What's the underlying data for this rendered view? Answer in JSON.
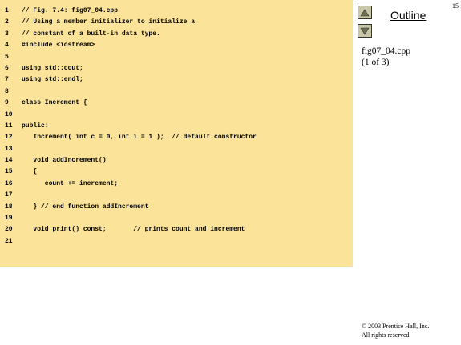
{
  "page_number": "15",
  "nav": {
    "up_icon": "triangle-up",
    "down_icon": "triangle-down",
    "outline_label": "Outline"
  },
  "file_caption": {
    "name": "fig07_04.cpp",
    "pages": "(1 of 3)"
  },
  "copyright": {
    "line1": "© 2003 Prentice Hall, Inc.",
    "line2": "All rights reserved."
  },
  "code": [
    {
      "n": "1",
      "text": "// Fig. 7.4: fig07_04.cpp"
    },
    {
      "n": "2",
      "text": "// Using a member initializer to initialize a"
    },
    {
      "n": "3",
      "text": "// constant of a built-in data type."
    },
    {
      "n": "4",
      "text": "#include <iostream>"
    },
    {
      "n": "5",
      "text": ""
    },
    {
      "n": "6",
      "text": "using std::cout;"
    },
    {
      "n": "7",
      "text": "using std::endl;"
    },
    {
      "n": "8",
      "text": ""
    },
    {
      "n": "9",
      "text": "class Increment {"
    },
    {
      "n": "10",
      "text": ""
    },
    {
      "n": "11",
      "text": "public:"
    },
    {
      "n": "12",
      "text": "   Increment( int c = 0, int i = 1 );  // default constructor"
    },
    {
      "n": "13",
      "text": ""
    },
    {
      "n": "14",
      "text": "   void addIncrement()"
    },
    {
      "n": "15",
      "text": "   {"
    },
    {
      "n": "16",
      "text": "      count += increment;"
    },
    {
      "n": "17",
      "text": ""
    },
    {
      "n": "18",
      "text": "   } // end function addIncrement"
    },
    {
      "n": "19",
      "text": ""
    },
    {
      "n": "20",
      "text": "   void print() const;       // prints count and increment"
    },
    {
      "n": "21",
      "text": ""
    }
  ],
  "colors": {
    "code_background": "#fbe49a",
    "nav_button": "#c8c8a8"
  }
}
